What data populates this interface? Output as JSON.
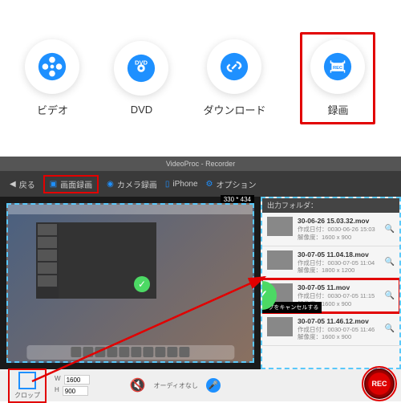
{
  "top": {
    "video": "ビデオ",
    "dvd": "DVD",
    "download": "ダウンロード",
    "record": "録画"
  },
  "recorder": {
    "title": "VideoProc - Recorder",
    "back": "戻る",
    "screen_rec": "画面録画",
    "camera_rec": "カメラ録画",
    "iphone": "iPhone",
    "options": "オプション",
    "output_folder": "出力フォルダ：",
    "dim_label": "330 * 434",
    "esc_tip": "ESCを押すとクロップをキャンセルする"
  },
  "files": [
    {
      "name": "30-06-26 15.03.32.mov",
      "date": "作成日付：0030-06-26 15:03",
      "res": "解像度：1600 x 900"
    },
    {
      "name": "30-07-05 11.04.18.mov",
      "date": "作成日付：0030-07-05 11:04",
      "res": "解像度：1800 x 1200"
    },
    {
      "name": "30-07-05 11.mov",
      "date": "作成日付：0030-07-05 11:15",
      "res": "解像度：1600 x 900"
    },
    {
      "name": "30-07-05 11.46.12.mov",
      "date": "作成日付：0030-07-05 11:46",
      "res": "解像度：1600 x 900"
    }
  ],
  "bottom": {
    "crop": "クロップ",
    "w": "W",
    "h": "H",
    "wval": "1600",
    "hval": "900",
    "audio_off": "オーディオなし",
    "rec": "REC"
  }
}
